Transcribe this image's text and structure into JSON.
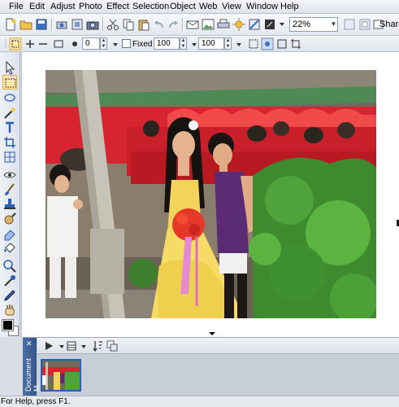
{
  "menu": {
    "items": [
      "File",
      "Edit",
      "Adjust",
      "Photo",
      "Effect",
      "Selection",
      "Object",
      "Web",
      "View",
      "Window",
      "Help"
    ]
  },
  "toolbar": {
    "zoom_value": "22%",
    "share_label": "Share"
  },
  "options": {
    "feather_value": "0",
    "fixed_label": "Fixed",
    "width_value": "100",
    "height_value": "100"
  },
  "document_manager": {
    "title": "Document M..."
  },
  "status": {
    "text": "For Help, press F1."
  },
  "icons": {
    "tools": [
      "pointer-icon",
      "marquee-icon",
      "lasso-icon",
      "magic-wand-icon",
      "text-icon",
      "crop-icon",
      "straighten-icon",
      "eye-icon",
      "brush-icon",
      "clone-stamp-icon",
      "smudge-icon",
      "eraser-icon",
      "bucket-icon",
      "zoom-icon",
      "eyedropper-icon",
      "pen-icon",
      "hand-icon"
    ]
  },
  "colors": {
    "accent": "#2c5fb0",
    "foreground": "#000000",
    "background": "#ffffff"
  }
}
